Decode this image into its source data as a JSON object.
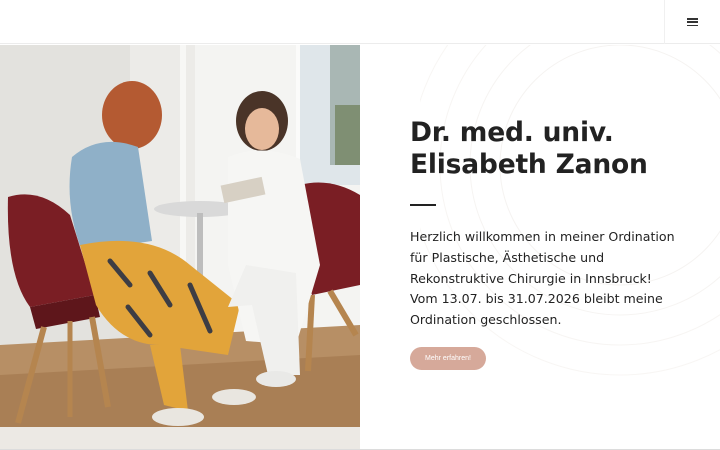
{
  "header": {
    "menu_icon": "hamburger-menu-icon"
  },
  "hero": {
    "title_line1": "Dr. med. univ.",
    "title_line2": "Elisabeth Zanon",
    "intro": "Herzlich willkommen in meiner Ordination für Plastische,  Ästhetische und Rekonstruktive Chirurgie in Innsbruck! Vom 13.07. bis 31.07.2026 bleibt meine Ordination geschlossen.",
    "cta_label": "Mehr erfahren!"
  },
  "colors": {
    "accent": "#d6a99a",
    "text": "#222222",
    "background": "#ffffff"
  }
}
